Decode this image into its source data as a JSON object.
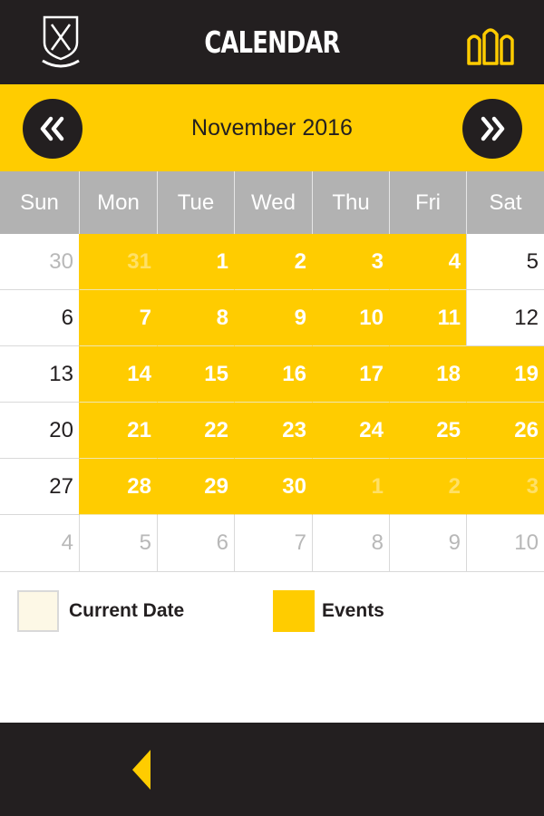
{
  "header": {
    "title": "CALENDAR",
    "logo_icon": "school-crest-icon",
    "museum_icon": "museum-icon"
  },
  "month_nav": {
    "label": "November 2016",
    "prev_label": "«",
    "next_label": "»"
  },
  "weekdays": [
    "Sun",
    "Mon",
    "Tue",
    "Wed",
    "Thu",
    "Fri",
    "Sat"
  ],
  "weeks": [
    [
      {
        "day": "30",
        "muted": true,
        "event": false
      },
      {
        "day": "31",
        "muted": true,
        "event": true
      },
      {
        "day": "1",
        "muted": false,
        "event": true
      },
      {
        "day": "2",
        "muted": false,
        "event": true
      },
      {
        "day": "3",
        "muted": false,
        "event": true
      },
      {
        "day": "4",
        "muted": false,
        "event": true
      },
      {
        "day": "5",
        "muted": false,
        "event": false
      }
    ],
    [
      {
        "day": "6",
        "muted": false,
        "event": false
      },
      {
        "day": "7",
        "muted": false,
        "event": true
      },
      {
        "day": "8",
        "muted": false,
        "event": true
      },
      {
        "day": "9",
        "muted": false,
        "event": true
      },
      {
        "day": "10",
        "muted": false,
        "event": true
      },
      {
        "day": "11",
        "muted": false,
        "event": true
      },
      {
        "day": "12",
        "muted": false,
        "event": false
      }
    ],
    [
      {
        "day": "13",
        "muted": false,
        "event": false
      },
      {
        "day": "14",
        "muted": false,
        "event": true
      },
      {
        "day": "15",
        "muted": false,
        "event": true
      },
      {
        "day": "16",
        "muted": false,
        "event": true
      },
      {
        "day": "17",
        "muted": false,
        "event": true
      },
      {
        "day": "18",
        "muted": false,
        "event": true
      },
      {
        "day": "19",
        "muted": false,
        "event": true
      }
    ],
    [
      {
        "day": "20",
        "muted": false,
        "event": false
      },
      {
        "day": "21",
        "muted": false,
        "event": true
      },
      {
        "day": "22",
        "muted": false,
        "event": true
      },
      {
        "day": "23",
        "muted": false,
        "event": true
      },
      {
        "day": "24",
        "muted": false,
        "event": true
      },
      {
        "day": "25",
        "muted": false,
        "event": true
      },
      {
        "day": "26",
        "muted": false,
        "event": true
      }
    ],
    [
      {
        "day": "27",
        "muted": false,
        "event": false
      },
      {
        "day": "28",
        "muted": false,
        "event": true
      },
      {
        "day": "29",
        "muted": false,
        "event": true
      },
      {
        "day": "30",
        "muted": false,
        "event": true
      },
      {
        "day": "1",
        "muted": true,
        "event": true
      },
      {
        "day": "2",
        "muted": true,
        "event": true
      },
      {
        "day": "3",
        "muted": true,
        "event": true
      }
    ],
    [
      {
        "day": "4",
        "muted": true,
        "event": false
      },
      {
        "day": "5",
        "muted": true,
        "event": false
      },
      {
        "day": "6",
        "muted": true,
        "event": false
      },
      {
        "day": "7",
        "muted": true,
        "event": false
      },
      {
        "day": "8",
        "muted": true,
        "event": false
      },
      {
        "day": "9",
        "muted": true,
        "event": false
      },
      {
        "day": "10",
        "muted": true,
        "event": false
      }
    ]
  ],
  "legend": {
    "current_date_label": "Current Date",
    "events_label": "Events"
  },
  "footer": {
    "back_icon": "back-arrow-icon"
  },
  "colors": {
    "accent": "#ffcc00",
    "dark": "#231f20",
    "weekday_header": "#b2b2b2",
    "current_date_swatch": "#fdf8e6"
  }
}
